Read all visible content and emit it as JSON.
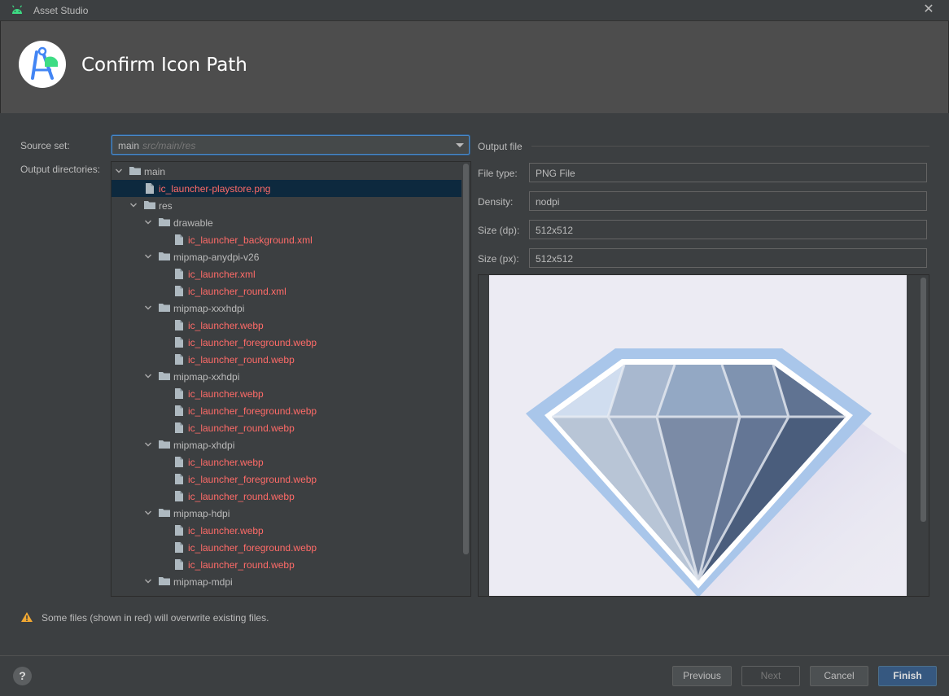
{
  "window": {
    "title": "Asset Studio",
    "close_icon": "close-icon"
  },
  "header": {
    "title": "Confirm Icon Path",
    "logo_icon": "android-studio-logo"
  },
  "form": {
    "source_set_label": "Source set:",
    "source_set_value": "main",
    "source_set_hint": "src/main/res",
    "output_dirs_label": "Output directories:"
  },
  "tree": [
    {
      "label": "main",
      "type": "folder",
      "depth": 0,
      "expanded": true
    },
    {
      "label": "ic_launcher-playstore.png",
      "type": "file",
      "depth": 1,
      "selected": true
    },
    {
      "label": "res",
      "type": "folder",
      "depth": 1,
      "expanded": true
    },
    {
      "label": "drawable",
      "type": "folder",
      "depth": 2,
      "expanded": true
    },
    {
      "label": "ic_launcher_background.xml",
      "type": "file",
      "depth": 3
    },
    {
      "label": "mipmap-anydpi-v26",
      "type": "folder",
      "depth": 2,
      "expanded": true
    },
    {
      "label": "ic_launcher.xml",
      "type": "file",
      "depth": 3
    },
    {
      "label": "ic_launcher_round.xml",
      "type": "file",
      "depth": 3
    },
    {
      "label": "mipmap-xxxhdpi",
      "type": "folder",
      "depth": 2,
      "expanded": true
    },
    {
      "label": "ic_launcher.webp",
      "type": "file",
      "depth": 3
    },
    {
      "label": "ic_launcher_foreground.webp",
      "type": "file",
      "depth": 3
    },
    {
      "label": "ic_launcher_round.webp",
      "type": "file",
      "depth": 3
    },
    {
      "label": "mipmap-xxhdpi",
      "type": "folder",
      "depth": 2,
      "expanded": true
    },
    {
      "label": "ic_launcher.webp",
      "type": "file",
      "depth": 3
    },
    {
      "label": "ic_launcher_foreground.webp",
      "type": "file",
      "depth": 3
    },
    {
      "label": "ic_launcher_round.webp",
      "type": "file",
      "depth": 3
    },
    {
      "label": "mipmap-xhdpi",
      "type": "folder",
      "depth": 2,
      "expanded": true
    },
    {
      "label": "ic_launcher.webp",
      "type": "file",
      "depth": 3
    },
    {
      "label": "ic_launcher_foreground.webp",
      "type": "file",
      "depth": 3
    },
    {
      "label": "ic_launcher_round.webp",
      "type": "file",
      "depth": 3
    },
    {
      "label": "mipmap-hdpi",
      "type": "folder",
      "depth": 2,
      "expanded": true
    },
    {
      "label": "ic_launcher.webp",
      "type": "file",
      "depth": 3
    },
    {
      "label": "ic_launcher_foreground.webp",
      "type": "file",
      "depth": 3
    },
    {
      "label": "ic_launcher_round.webp",
      "type": "file",
      "depth": 3
    },
    {
      "label": "mipmap-mdpi",
      "type": "folder",
      "depth": 2,
      "expanded": true
    }
  ],
  "output": {
    "section_title": "Output file",
    "file_type_label": "File type:",
    "file_type_value": "PNG File",
    "density_label": "Density:",
    "density_value": "nodpi",
    "size_dp_label": "Size (dp):",
    "size_dp_value": "512x512",
    "size_px_label": "Size (px):",
    "size_px_value": "512x512"
  },
  "warning": {
    "icon": "warning-icon",
    "text": "Some files (shown in red) will overwrite existing files."
  },
  "footer": {
    "help_label": "?",
    "previous_label": "Previous",
    "next_label": "Next",
    "cancel_label": "Cancel",
    "finish_label": "Finish"
  },
  "colors": {
    "accent": "#365880",
    "overwrite_red": "#ff6b68",
    "selection": "#0d293e"
  }
}
